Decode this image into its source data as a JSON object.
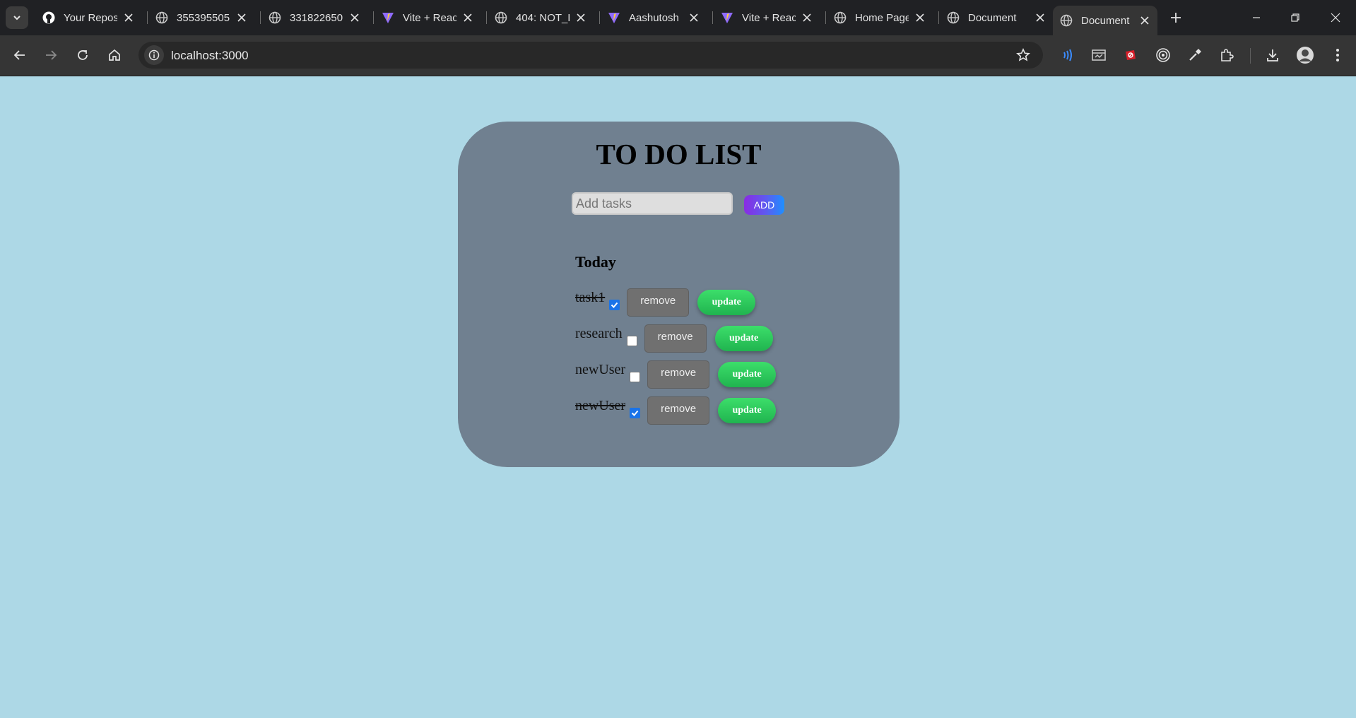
{
  "browser": {
    "tabs": [
      {
        "title": "Your Repos",
        "icon": "github-icon"
      },
      {
        "title": "355395505",
        "icon": "globe-icon"
      },
      {
        "title": "331822650",
        "icon": "globe-icon"
      },
      {
        "title": "Vite + React",
        "icon": "vite-icon"
      },
      {
        "title": "404: NOT_F",
        "icon": "globe-icon"
      },
      {
        "title": "Aashutosh",
        "icon": "vite-icon"
      },
      {
        "title": "Vite + React",
        "icon": "vite-icon"
      },
      {
        "title": "Home Page",
        "icon": "globe-icon"
      },
      {
        "title": "Document",
        "icon": "globe-icon"
      },
      {
        "title": "Document",
        "icon": "globe-icon",
        "active": true
      }
    ],
    "url": "localhost:3000"
  },
  "app": {
    "heading": "TO DO LIST",
    "input_placeholder": "Add tasks",
    "add_label": "ADD",
    "section_title": "Today",
    "tasks": [
      {
        "label": "task1",
        "done": true
      },
      {
        "label": "research",
        "done": false
      },
      {
        "label": "newUser",
        "done": false
      },
      {
        "label": "newUser",
        "done": true
      }
    ],
    "remove_label": "remove",
    "update_label": "update"
  },
  "colors": {
    "page_background": "#add8e6",
    "card_background": "#708090",
    "update_button": "#2ecc5f",
    "checkbox_checked": "#1a73e8"
  }
}
